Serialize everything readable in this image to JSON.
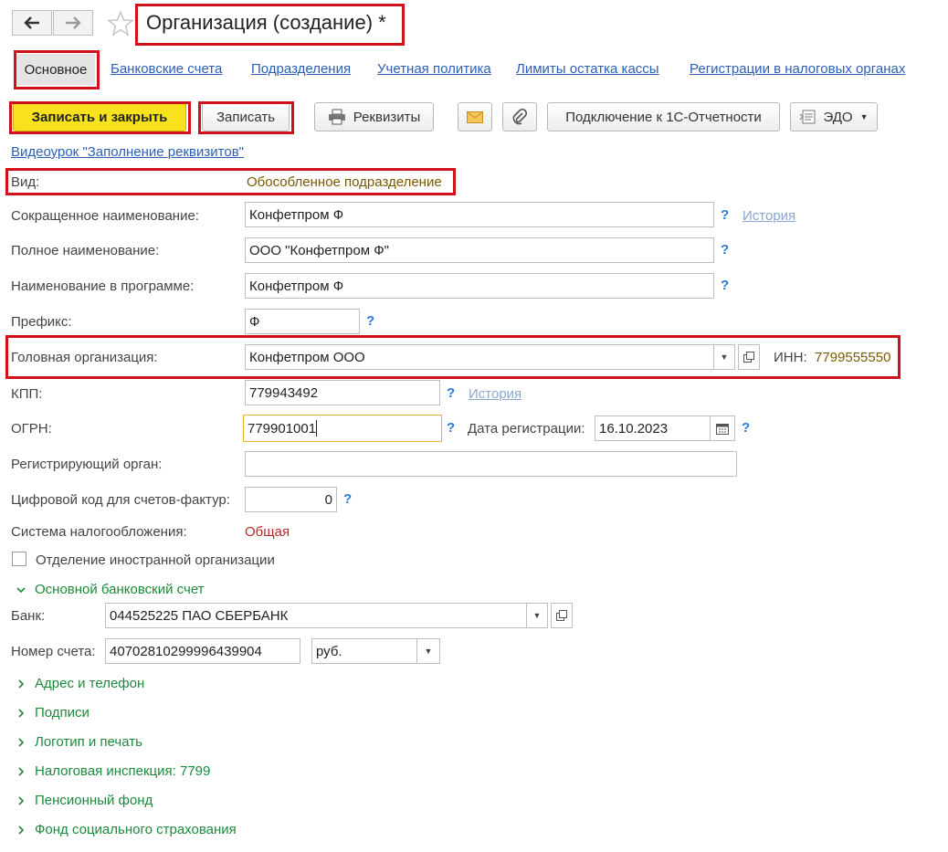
{
  "window": {
    "title": "Организация (создание) *"
  },
  "tabs": [
    {
      "label": "Основное",
      "active": true
    },
    {
      "label": "Банковские счета"
    },
    {
      "label": "Подразделения"
    },
    {
      "label": "Учетная политика"
    },
    {
      "label": "Лимиты остатка кассы"
    },
    {
      "label": "Регистрации в налоговых органах"
    }
  ],
  "toolbar": {
    "save_close": "Записать и закрыть",
    "save": "Записать",
    "requisites": "Реквизиты",
    "mail_icon": "envelope-icon",
    "attach_icon": "paperclip-icon",
    "connect": "Подключение к 1С-Отчетности",
    "edo": "ЭДО"
  },
  "video_link": "Видеоурок \"Заполнение реквизитов\"",
  "form": {
    "kind": {
      "label": "Вид:",
      "value": "Обособленное подразделение"
    },
    "short_name": {
      "label": "Сокращенное наименование:",
      "value": "Конфетпром Ф",
      "history": "История"
    },
    "full_name": {
      "label": "Полное наименование:",
      "value": "ООО \"Конфетпром Ф\""
    },
    "program_name": {
      "label": "Наименование в программе:",
      "value": "Конфетпром Ф"
    },
    "prefix": {
      "label": "Префикс:",
      "value": "Ф"
    },
    "head_org": {
      "label": "Головная организация:",
      "value": "Конфетпром ООО",
      "inn_label": "ИНН:",
      "inn_value": "7799555550"
    },
    "kpp": {
      "label": "КПП:",
      "value": "779943492",
      "history": "История"
    },
    "ogrn": {
      "label": "ОГРН:",
      "value": "779901001",
      "reg_date_label": "Дата регистрации:",
      "reg_date": "16.10.2023"
    },
    "reg_authority": {
      "label": "Регистрирующий орган:",
      "value": ""
    },
    "digital_code": {
      "label": "Цифровой код для счетов-фактур:",
      "value": "0"
    },
    "tax_system": {
      "label": "Система налогообложения:",
      "value": "Общая"
    },
    "foreign_branch": {
      "label": "Отделение иностранной организации",
      "checked": false
    },
    "help_mark": "?"
  },
  "bank_section": {
    "title": "Основной банковский счет",
    "bank_label": "Банк:",
    "bank_value": "044525225 ПАО СБЕРБАНК",
    "account_label": "Номер счета:",
    "account_value": "40702810299996439904",
    "currency": "руб."
  },
  "sections": [
    "Адрес и телефон",
    "Подписи",
    "Логотип и печать",
    "Налоговая инспекция: 7799",
    "Пенсионный фонд",
    "Фонд социального страхования"
  ],
  "colors": {
    "highlight": "#d0101a",
    "primary_button": "#f8e21e",
    "link": "#2c5fb3",
    "section": "#1c8a3a",
    "value_brown": "#7a5a00",
    "tax_red": "#b52a2a"
  }
}
